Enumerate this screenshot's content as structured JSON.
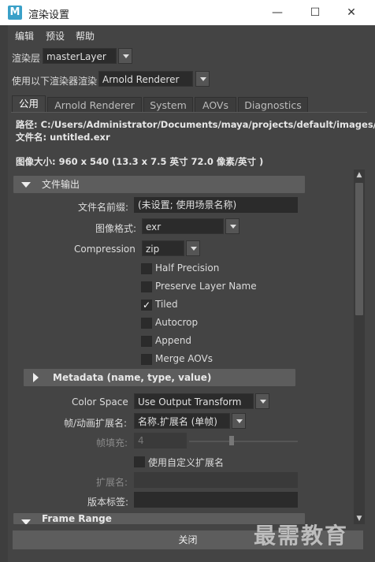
{
  "window": {
    "title": "渲染设置",
    "app_icon_letter": "M",
    "controls": [
      "—",
      "☐",
      "✕"
    ]
  },
  "menu": [
    "编辑",
    "预设",
    "帮助"
  ],
  "render_layer": {
    "label": "渲染层",
    "value": "masterLayer"
  },
  "renderer": {
    "label": "使用以下渲染器渲染",
    "value": "Arnold Renderer"
  },
  "tabs": [
    "公用",
    "Arnold Renderer",
    "System",
    "AOVs",
    "Diagnostics"
  ],
  "info": {
    "path": "路径: C:/Users/Administrator/Documents/maya/projects/default/images/",
    "filename": "文件名: untitled.exr",
    "image_size": "图像大小: 960 x 540 (13.3 x 7.5 英寸 72.0 像素/英寸 )"
  },
  "file_output": {
    "header": "文件输出",
    "prefix_label": "文件名前缀:",
    "prefix_value": "(未设置; 使用场景名称)",
    "format_label": "图像格式:",
    "format_value": "exr",
    "compression_label": "Compression",
    "compression_value": "zip",
    "checkboxes": [
      {
        "label": "Half Precision",
        "checked": false
      },
      {
        "label": "Preserve Layer Name",
        "checked": false
      },
      {
        "label": "Tiled",
        "checked": true
      },
      {
        "label": "Autocrop",
        "checked": false
      },
      {
        "label": "Append",
        "checked": false
      },
      {
        "label": "Merge AOVs",
        "checked": false
      }
    ],
    "metadata_header": "Metadata (name, type, value)",
    "color_space_label": "Color Space",
    "color_space_value": "Use Output Transform",
    "frame_ext_label": "帧/动画扩展名:",
    "frame_ext_value": "名称.扩展名 (单帧)",
    "padding_label": "帧填充:",
    "padding_value": "4",
    "padding_level": 0.6,
    "custom_ext_label": "使用自定义扩展名",
    "custom_ext_checked": false,
    "ext_label": "扩展名:",
    "ext_value": "",
    "version_label": "版本标签:",
    "version_value": ""
  },
  "frame_range_header": "Frame Range",
  "close_button": "关闭",
  "watermark": "最需教育",
  "colors": {
    "background": "#444444",
    "field": "#2b2b2b",
    "header": "#5d5d5d"
  }
}
